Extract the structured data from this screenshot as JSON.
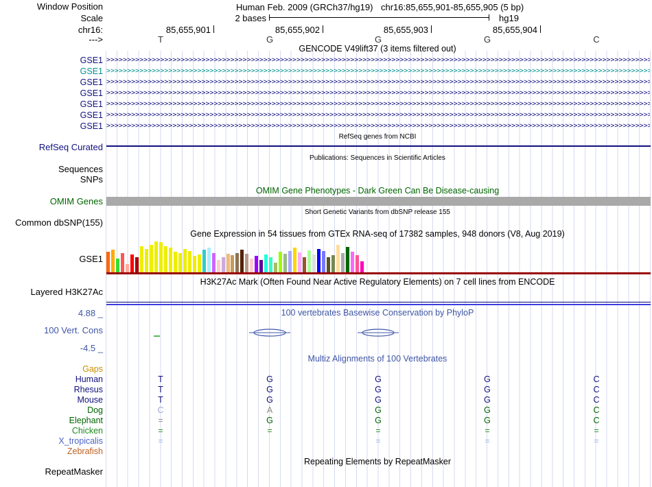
{
  "header": {
    "window_position_label": "Window Position",
    "assembly_title": "Human Feb. 2009 (GRCh37/hg19)",
    "position_title": "chr16:85,655,901-85,655,905 (5 bp)",
    "scale_label": "Scale",
    "scale_value": "2 bases",
    "assembly_short": "hg19",
    "chrom_label": "chr16:",
    "coords": [
      "85,655,901",
      "85,655,902",
      "85,655,903",
      "85,655,904"
    ],
    "strand_label": "--->",
    "bases": [
      "T",
      "G",
      "G",
      "G",
      "C"
    ]
  },
  "gencode": {
    "title": "GENCODE V49lift37 (3 items filtered out)",
    "genes": [
      {
        "label": "GSE1",
        "color": "#10107E"
      },
      {
        "label": "GSE1",
        "color": "#00918F"
      },
      {
        "label": "GSE1",
        "color": "#10107E"
      },
      {
        "label": "GSE1",
        "color": "#10107E"
      },
      {
        "label": "GSE1",
        "color": "#10107E"
      },
      {
        "label": "GSE1",
        "color": "#10107E"
      },
      {
        "label": "GSE1",
        "color": "#10107E"
      }
    ]
  },
  "refseq": {
    "subtitle": "RefSeq genes from NCBI",
    "label": "RefSeq Curated"
  },
  "publications": {
    "subtitle": "Publications: Sequences in Scientific Articles",
    "label_sequences": "Sequences",
    "label_snps": "SNPs"
  },
  "omim": {
    "title": "OMIM Gene Phenotypes - Dark Green Can Be Disease-causing",
    "label": "OMIM Genes",
    "bar_color": "#A9A9A9"
  },
  "dbsnp": {
    "subtitle": "Short Genetic Variants from dbSNP release 155",
    "label": "Common dbSNP(155)"
  },
  "gtex": {
    "title": "Gene Expression in 54 tissues from GTEx RNA-seq of 17382 samples, 948 donors (V8, Aug 2019)",
    "label": "GSE1",
    "baseline_color": "#990000"
  },
  "chart_data": {
    "type": "bar",
    "title": "Gene Expression in 54 tissues from GTEx RNA-seq of 17382 samples, 948 donors (V8, Aug 2019)",
    "values": [
      30,
      33,
      20,
      28,
      12,
      26,
      22,
      38,
      34,
      40,
      45,
      44,
      38,
      36,
      30,
      28,
      34,
      31,
      24,
      26,
      33,
      36,
      28,
      18,
      22,
      27,
      25,
      28,
      33,
      27,
      20,
      24,
      18,
      26,
      22,
      14,
      30,
      27,
      31,
      36,
      29,
      22,
      32,
      26,
      34,
      31,
      22,
      25,
      40,
      28,
      37,
      30,
      25,
      16
    ],
    "colors": [
      "#FF6600",
      "#FFAA00",
      "#33DD33",
      "#FF5555",
      "#FFAA99",
      "#FF0000",
      "#AA0000",
      "#EEEE00",
      "#EEEE00",
      "#EEEE00",
      "#EEEE00",
      "#EEEE00",
      "#EEEE00",
      "#EEEE00",
      "#EEEE00",
      "#EEEE00",
      "#EEEE00",
      "#EEEE00",
      "#EEEE00",
      "#EEEE00",
      "#33CCCC",
      "#AAEEFF",
      "#CC66FF",
      "#FFCCCC",
      "#CCAADD",
      "#EEBB77",
      "#CC9955",
      "#8B7355",
      "#552200",
      "#BB9988",
      "#FFCCCC",
      "#9900FF",
      "#660099",
      "#22FFDD",
      "#33FFC2",
      "#AABB66",
      "#99FF00",
      "#99BB88",
      "#AAAAFF",
      "#FFD700",
      "#FFAAFF",
      "#995522",
      "#AAFF99",
      "#DDDDDD",
      "#0000FF",
      "#7777FF",
      "#555522",
      "#778855",
      "#FFDD99",
      "#AAAAAA",
      "#006600",
      "#FF66FF",
      "#FF5599",
      "#FF00BB"
    ]
  },
  "h3k27ac": {
    "title": "H3K27Ac Mark (Often Found Near Active Regulatory Elements) on 7 cell lines from ENCODE",
    "label": "Layered H3K27Ac"
  },
  "conservation": {
    "title": "100 vertebrates Basewise Conservation by PhyloP",
    "label": "100 Vert. Cons",
    "max_value": "4.88 _",
    "min_value": "-4.5 _"
  },
  "multiz": {
    "title": "Multiz Alignments of 100 Vertebrates",
    "rows": [
      {
        "label": "Gaps",
        "label_color": "#C49000",
        "cell_color": "#C49000",
        "cells": [
          "",
          "",
          "",
          "",
          ""
        ]
      },
      {
        "label": "Human",
        "label_color": "#10107E",
        "cell_color": "#10107E",
        "cells": [
          "T",
          "G",
          "G",
          "G",
          "C"
        ]
      },
      {
        "label": "Rhesus",
        "label_color": "#10107E",
        "cell_color": "#10107E",
        "cells": [
          "T",
          "G",
          "G",
          "G",
          "C"
        ]
      },
      {
        "label": "Mouse",
        "label_color": "#10107E",
        "cell_color": "#10107E",
        "cells": [
          "T",
          "G",
          "G",
          "G",
          "C"
        ]
      },
      {
        "label": "Dog",
        "label_color": "#006400",
        "cell_color": "#006400",
        "cells": [
          "C",
          "A",
          "G",
          "G",
          "C"
        ],
        "cell_overrides": {
          "0": "#A0AACF",
          "1": "#8C8C8C"
        }
      },
      {
        "label": "Elephant",
        "label_color": "#006400",
        "cell_color": "#006400",
        "cells": [
          "=",
          "G",
          "G",
          "G",
          "C"
        ],
        "cell_overrides": {
          "0": "#8C8C8C"
        }
      },
      {
        "label": "Chicken",
        "label_color": "#1F8A1F",
        "cell_color": "#2F8F2F",
        "cells": [
          "=",
          "=",
          "=",
          "=",
          "="
        ]
      },
      {
        "label": "X_tropicalis",
        "label_color": "#4A63C8",
        "cell_color": "#9DB4E0",
        "cells": [
          "=",
          "",
          "=",
          "=",
          "="
        ]
      },
      {
        "label": "Zebrafish",
        "label_color": "#C06020",
        "cell_color": "#C06020",
        "cells": [
          "",
          "",
          "",
          "",
          ""
        ]
      }
    ]
  },
  "repeatmasker": {
    "title": "Repeating Elements by RepeatMasker",
    "label": "RepeatMasker"
  }
}
